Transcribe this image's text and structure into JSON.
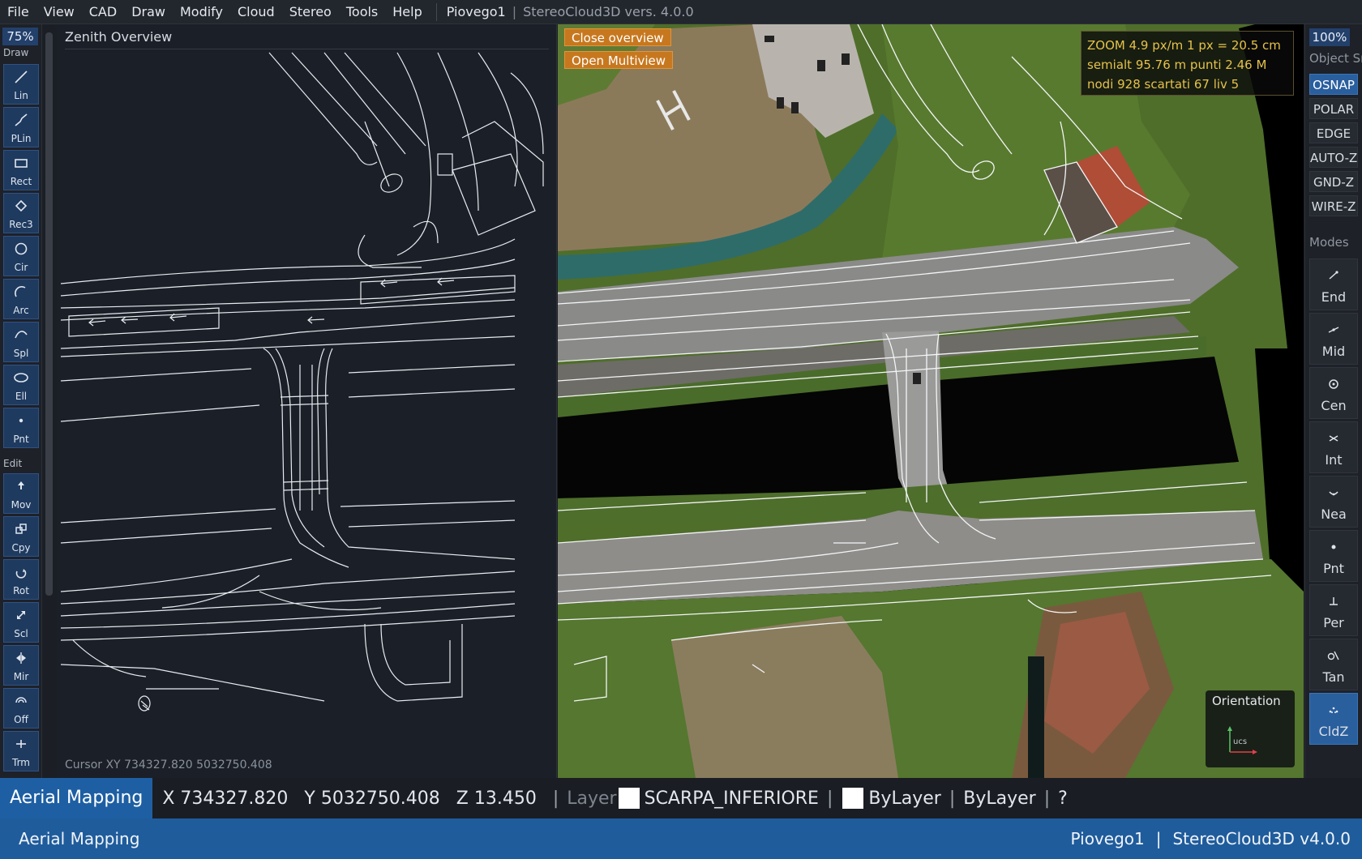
{
  "menubar": {
    "items": [
      "File",
      "View",
      "CAD",
      "Draw",
      "Modify",
      "Cloud",
      "Stereo",
      "Tools",
      "Help"
    ],
    "project": "Piovego1",
    "app_version": "StereoCloud3D vers. 4.0.0"
  },
  "left_toolbar": {
    "zoom": "75%",
    "draw_label": "Draw",
    "edit_label": "Edit",
    "draw_tools": [
      {
        "label": "Lin",
        "icon": "line-icon"
      },
      {
        "label": "PLin",
        "icon": "polyline-icon"
      },
      {
        "label": "Rect",
        "icon": "rectangle-icon"
      },
      {
        "label": "Rec3",
        "icon": "rect3-icon"
      },
      {
        "label": "Cir",
        "icon": "circle-icon"
      },
      {
        "label": "Arc",
        "icon": "arc-icon"
      },
      {
        "label": "Spl",
        "icon": "spline-icon"
      },
      {
        "label": "Ell",
        "icon": "ellipse-icon"
      },
      {
        "label": "Pnt",
        "icon": "point-icon"
      }
    ],
    "edit_tools": [
      {
        "label": "Mov",
        "icon": "move-icon"
      },
      {
        "label": "Cpy",
        "icon": "copy-icon"
      },
      {
        "label": "Rot",
        "icon": "rotate-icon"
      },
      {
        "label": "Scl",
        "icon": "scale-icon"
      },
      {
        "label": "Mir",
        "icon": "mirror-icon"
      },
      {
        "label": "Off",
        "icon": "offset-icon"
      },
      {
        "label": "Trm",
        "icon": "trim-icon"
      }
    ]
  },
  "overview": {
    "title": "Zenith Overview",
    "cursor": "Cursor XY   734327.820   5032750.408"
  },
  "view3d": {
    "close_overview": "Close overview",
    "open_multiview": "Open Multiview",
    "info": {
      "row1": "ZOOM  4.9 px/m    1 px = 20.5 cm",
      "row2": "semialt 95.76 m       punti 2.46 M",
      "row3": "nodi 928   scartati 67   liv 5"
    },
    "orientation": "Orientation",
    "orientation_axis": "ucs"
  },
  "right_toolbar": {
    "zoom": "100%",
    "object_snap": "Object Snap",
    "modes_label": "Modes",
    "modes": [
      {
        "label": "OSNAP",
        "active": true
      },
      {
        "label": "POLAR",
        "active": false
      },
      {
        "label": "EDGE",
        "active": false
      },
      {
        "label": "AUTO-Z",
        "active": false
      },
      {
        "label": "GND-Z",
        "active": false
      },
      {
        "label": "WIRE-Z",
        "active": false
      }
    ],
    "snaps": [
      {
        "label": "End",
        "icon": "endpoint-icon",
        "active": false
      },
      {
        "label": "Mid",
        "icon": "midpoint-icon",
        "active": false
      },
      {
        "label": "Cen",
        "icon": "center-icon",
        "active": false
      },
      {
        "label": "Int",
        "icon": "intersection-icon",
        "active": false
      },
      {
        "label": "Nea",
        "icon": "nearest-icon",
        "active": false
      },
      {
        "label": "Pnt",
        "icon": "node-icon",
        "active": false
      },
      {
        "label": "Per",
        "icon": "perpendicular-icon",
        "active": false
      },
      {
        "label": "Tan",
        "icon": "tangent-icon",
        "active": false
      },
      {
        "label": "CldZ",
        "icon": "cloud-z-icon",
        "active": true
      }
    ]
  },
  "status1": {
    "mode": "Aerial Mapping",
    "x": "X 734327.820",
    "y": "Y 5032750.408",
    "z": "Z 13.450",
    "layer_label": "Layer",
    "layer": "SCARPA_INFERIORE",
    "color": "ByLayer",
    "linetype": "ByLayer",
    "help": "?"
  },
  "status2": {
    "mode": "Aerial Mapping",
    "project": "Piovego1",
    "version": "StereoCloud3D v4.0.0"
  },
  "colors": {
    "accent": "#1e5fa3",
    "overlay_button": "#c7781f",
    "info_text": "#e5c24a"
  }
}
